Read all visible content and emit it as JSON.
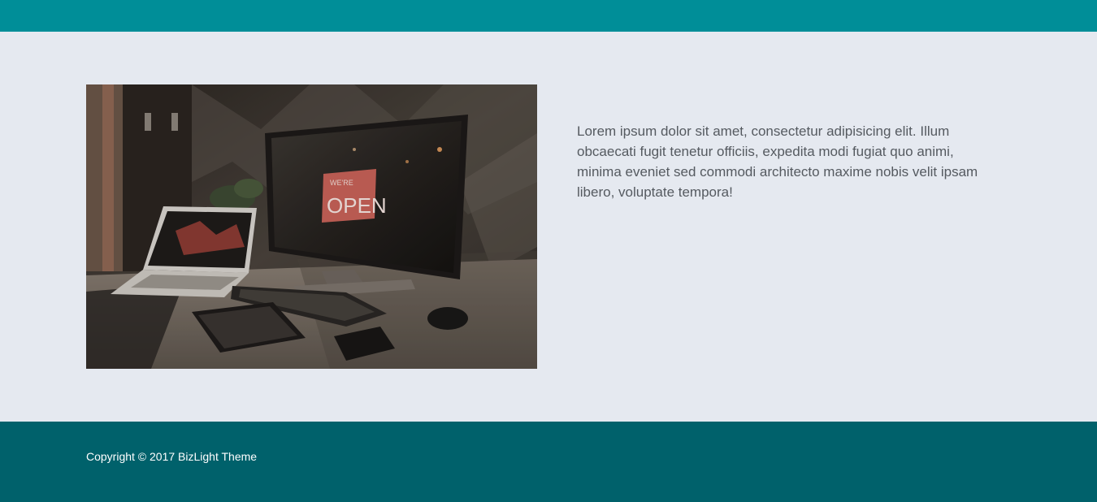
{
  "main": {
    "image_alt": "Desk with laptop, desktop monitor showing an OPEN sign reflection, keyboard, tablet, phone and mouse",
    "paragraph": "Lorem ipsum dolor sit amet, consectetur adipisicing elit. Illum obcaecati fugit tenetur officiis, expedita modi fugiat quo animi, minima eveniet sed commodi architecto maxime nobis velit ipsam libero, voluptate tempora!",
    "sign_small_text": "WE'RE",
    "sign_big_text": "OPEN"
  },
  "footer": {
    "copyright": "Copyright © 2017 BizLight Theme"
  },
  "colors": {
    "topbar": "#008e98",
    "content_bg": "#e5e9f0",
    "footer_bg": "#00616b",
    "text": "#555a60"
  }
}
